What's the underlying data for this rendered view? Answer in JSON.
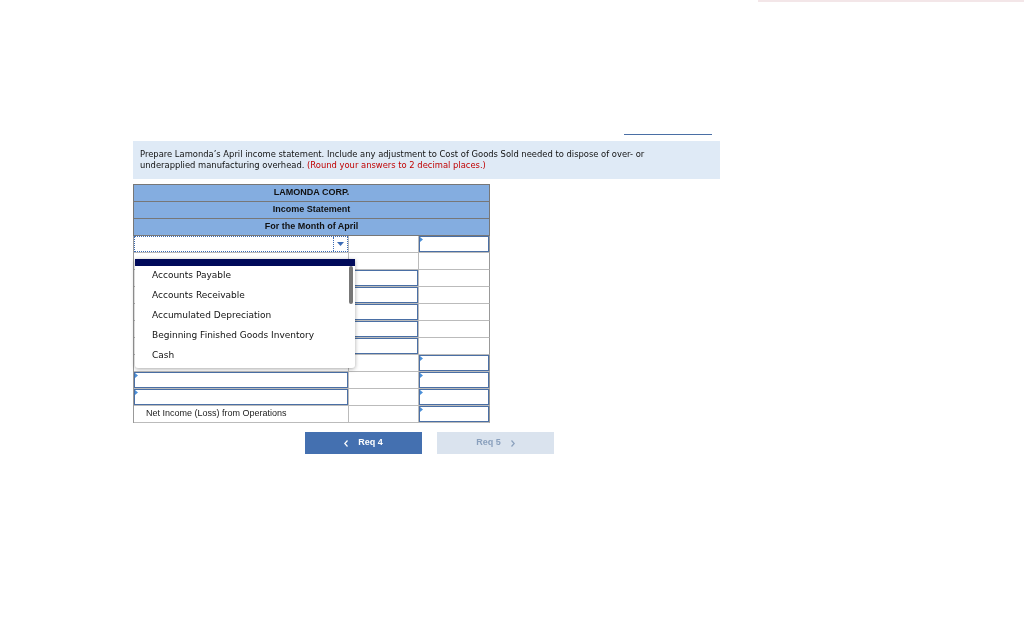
{
  "instructions": {
    "text": "Prepare Lamonda’s April income statement. Include any adjustment to Cost of Goods Sold needed to dispose of over- or underapplied manufacturing overhead.",
    "note": "(Round your answers to 2 decimal places.)"
  },
  "statement": {
    "headers": [
      "LAMONDA CORP.",
      "Income Statement",
      "For the Month of April"
    ],
    "rows": [
      {
        "cells": [
          {
            "kind": "select"
          },
          {
            "kind": "blank"
          },
          {
            "kind": "input"
          }
        ]
      },
      {
        "cells": [
          {
            "kind": "blank"
          },
          {
            "kind": "blank"
          },
          {
            "kind": "blank"
          }
        ]
      },
      {
        "cells": [
          {
            "kind": "blank"
          },
          {
            "kind": "input"
          },
          {
            "kind": "blank"
          }
        ]
      },
      {
        "cells": [
          {
            "kind": "blank"
          },
          {
            "kind": "input"
          },
          {
            "kind": "blank"
          }
        ]
      },
      {
        "cells": [
          {
            "kind": "blank"
          },
          {
            "kind": "input"
          },
          {
            "kind": "blank"
          }
        ]
      },
      {
        "cells": [
          {
            "kind": "blank"
          },
          {
            "kind": "input"
          },
          {
            "kind": "blank"
          }
        ]
      },
      {
        "cells": [
          {
            "kind": "blank"
          },
          {
            "kind": "input"
          },
          {
            "kind": "blank"
          }
        ]
      },
      {
        "cells": [
          {
            "kind": "blank"
          },
          {
            "kind": "blank"
          },
          {
            "kind": "input"
          }
        ]
      },
      {
        "cells": [
          {
            "kind": "input"
          },
          {
            "kind": "blank"
          },
          {
            "kind": "input"
          }
        ]
      },
      {
        "cells": [
          {
            "kind": "input"
          },
          {
            "kind": "blank"
          },
          {
            "kind": "input"
          }
        ]
      },
      {
        "cells": [
          {
            "kind": "label",
            "label": "Net Income (Loss) from Operations"
          },
          {
            "kind": "blank"
          },
          {
            "kind": "input"
          }
        ]
      }
    ]
  },
  "dropdown": {
    "options": [
      {
        "label": "Accounts Payable",
        "selected": false
      },
      {
        "label": "Accounts Receivable",
        "selected": false
      },
      {
        "label": "Accumulated Depreciation",
        "selected": false
      },
      {
        "label": "Beginning Finished Goods Inventory",
        "selected": false
      },
      {
        "label": "Cash",
        "selected": false
      }
    ]
  },
  "nav": [
    {
      "label": "Req 4",
      "kind": "prev",
      "disabled": false
    },
    {
      "label": "Req 5",
      "kind": "next",
      "disabled": true
    }
  ]
}
